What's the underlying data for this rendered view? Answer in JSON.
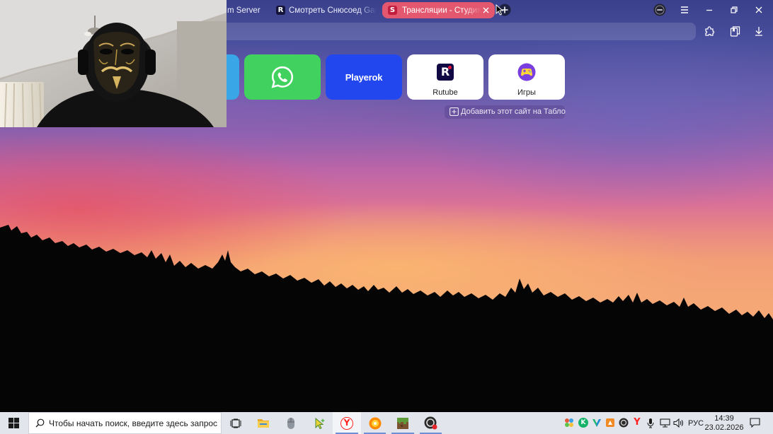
{
  "browser": {
    "tabs": [
      {
        "title": "m Server",
        "active": false
      },
      {
        "title": "Смотреть Снюсоед Gami",
        "active": false,
        "favicon": "rutube-icon",
        "favicon_letter": "R",
        "favicon_color": "#14143a"
      },
      {
        "title": "Трансляции - Студия R",
        "active": true,
        "favicon": "rutube-studio-icon",
        "favicon_letter": "S",
        "favicon_color": "#c21e3e"
      }
    ],
    "active_tab_color": "#e4586f",
    "toolbar_icons": [
      "extensions-icon",
      "collections-icon",
      "downloads-icon"
    ],
    "window_icons": [
      "profile-avatar-icon",
      "menu-icon",
      "minimize-icon",
      "restore-icon",
      "close-icon"
    ]
  },
  "tablo": {
    "tiles": [
      {
        "color": "#39a6e8"
      },
      {
        "icon": "whatsapp-icon",
        "color": "#41d15f"
      },
      {
        "label": "Playerok",
        "color": "#2347ef"
      },
      {
        "label": "Rutube",
        "icon": "rutube-logo-icon",
        "logo_letter": "R",
        "color": "#ffffff"
      },
      {
        "label": "Игры",
        "icon": "games-icon",
        "color": "#ffffff"
      }
    ],
    "add_site_label": "Добавить этот сайт на Табло"
  },
  "taskbar": {
    "search_placeholder": "Чтобы начать поиск, введите здесь запрос",
    "apps": [
      {
        "icon": "task-view-icon"
      },
      {
        "icon": "file-explorer-icon"
      },
      {
        "icon": "mouse-app-icon"
      },
      {
        "icon": "cursor-app-icon"
      },
      {
        "icon": "yandex-browser-icon",
        "active": true,
        "logo_letter": "Y"
      },
      {
        "icon": "music-app-icon",
        "running": true
      },
      {
        "icon": "minecraft-icon",
        "running": true
      },
      {
        "icon": "obs-icon",
        "running": true
      }
    ],
    "tray": {
      "icons": [
        "tray-helper-icon",
        "kaspersky-icon",
        "vpn-icon",
        "tray-orange-app-icon",
        "obs-tray-icon",
        "yandex-tray-icon",
        "microphone-icon",
        "network-icon",
        "volume-icon",
        "notification-icon"
      ],
      "kaspersky_letter": "K",
      "yandex_letter": "Y",
      "language": "РУС",
      "time": "14:39",
      "date": "23.02.2026"
    },
    "accent_color": "#6d8fd6"
  }
}
